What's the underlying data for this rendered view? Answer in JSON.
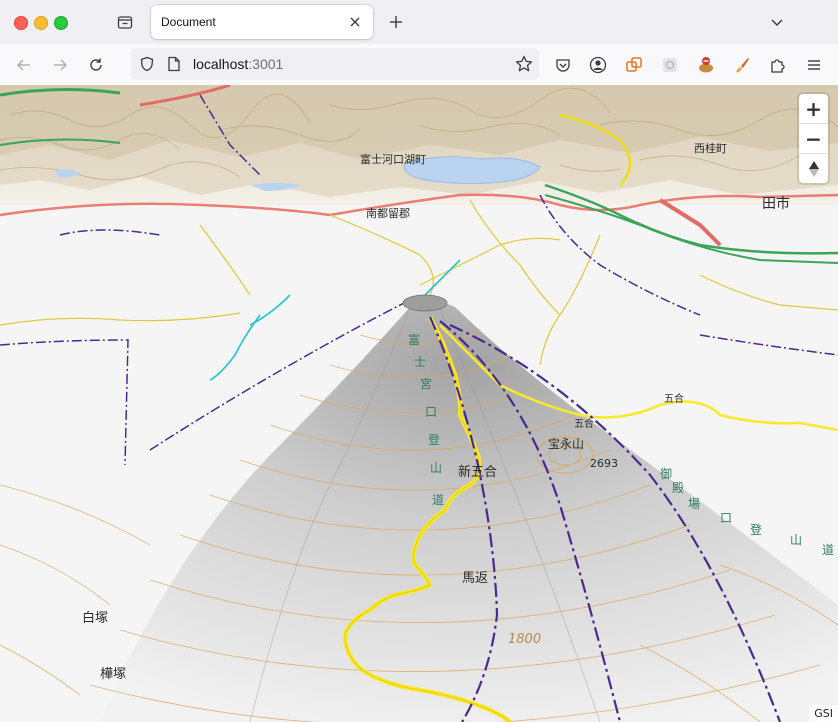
{
  "browser": {
    "tab_title": "Document",
    "url_host": "localhost",
    "url_port": ":3001"
  },
  "map": {
    "attribution": "GSI",
    "zoom_in_label": "+",
    "zoom_out_label": "−",
    "compass_label": "▲",
    "labels": {
      "fujikawaguchiko": "富士河口湖町",
      "nishikatsura": "西桂町",
      "minamitsuru": "南都留郡",
      "city": "田市",
      "shingogome": "新五合",
      "hoei_zan": "宝永山",
      "peak_2693": "2693",
      "magaeshi": "馬返",
      "contour_1800": "1800",
      "shiratsuka": "白塚",
      "kabatsuka": "樺塚",
      "gogome": "五合",
      "gogo_right": "五合"
    },
    "trail_fujinomiya": [
      "富",
      "士",
      "宮",
      "口",
      "登",
      "山",
      "道"
    ],
    "trail_gotemba": [
      "御",
      "殿",
      "場",
      "口",
      "登",
      "山",
      "道"
    ]
  }
}
